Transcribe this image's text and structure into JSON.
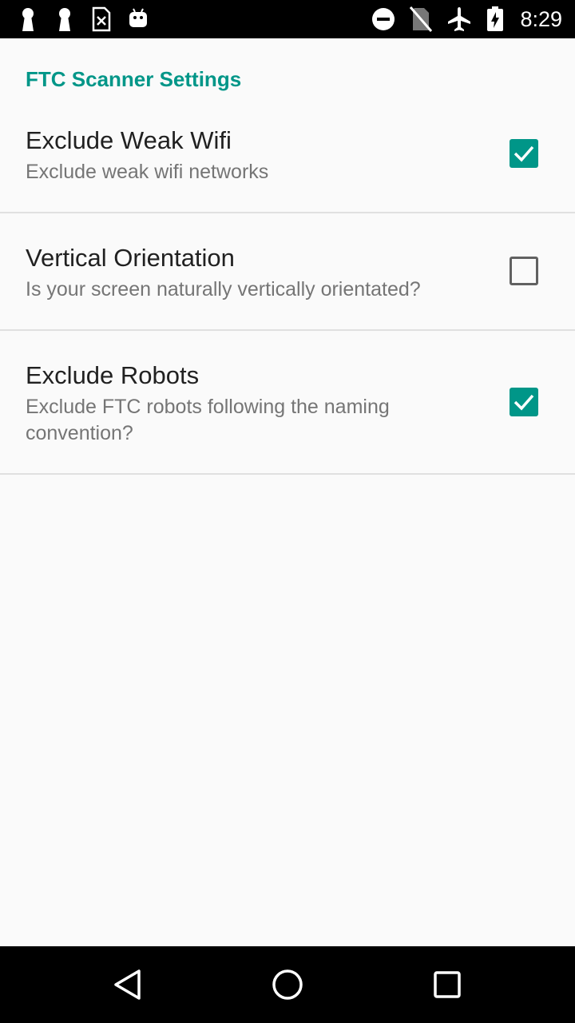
{
  "status_bar": {
    "time": "8:29",
    "left_icons": [
      "keyhole-icon",
      "keyhole-icon",
      "sim-x-icon",
      "android-icon"
    ],
    "right_icons": [
      "do-not-disturb-icon",
      "no-sim-icon",
      "airplane-mode-icon",
      "battery-charging-icon"
    ]
  },
  "settings": {
    "category_title": "FTC Scanner Settings",
    "items": [
      {
        "title": "Exclude Weak Wifi",
        "summary": "Exclude weak wifi networks",
        "checked": true
      },
      {
        "title": "Vertical Orientation",
        "summary": "Is your screen naturally vertically orientated?",
        "checked": false
      },
      {
        "title": "Exclude Robots",
        "summary": "Exclude FTC robots following the naming convention?",
        "checked": true
      }
    ]
  },
  "nav_bar": {
    "buttons": [
      "back-icon",
      "home-icon",
      "recents-icon"
    ]
  },
  "colors": {
    "accent": "#009688",
    "status_bar_bg": "#000000",
    "background": "#fafafa",
    "title_text": "#212121",
    "summary_text": "#757575"
  }
}
